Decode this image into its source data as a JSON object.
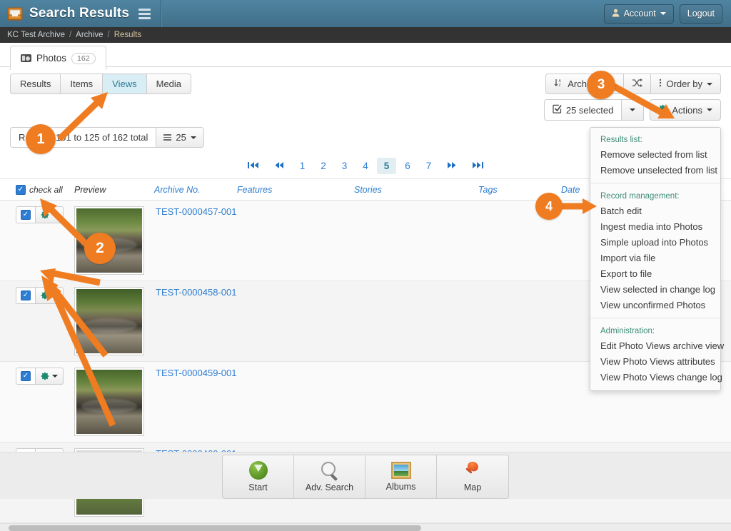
{
  "header": {
    "title": "Search Results",
    "logo_icon": "archive-box-icon",
    "menu_icon": "hamburger-icon",
    "account_label": "Account",
    "account_icon": "user-icon",
    "logout_label": "Logout"
  },
  "breadcrumb": {
    "items": [
      "KC Test Archive",
      "Archive",
      "Results"
    ],
    "separator": "/"
  },
  "tabs": {
    "photos": {
      "label": "Photos",
      "count": "162",
      "icon": "camera-icon"
    }
  },
  "subtabs": [
    {
      "label": "Results",
      "active": false
    },
    {
      "label": "Items",
      "active": false
    },
    {
      "label": "Views",
      "active": true
    },
    {
      "label": "Media",
      "active": false
    }
  ],
  "records": {
    "summary": "Records 101 to 125 of 162 total",
    "page_size": "25",
    "page_size_icon": "list-icon"
  },
  "toolbar": {
    "sort_label": "Archive No.",
    "sort_icon": "sort-alpha-icon",
    "shuffle_icon": "shuffle-icon",
    "order_by_label": "Order by",
    "order_by_icon": "dots-vertical-icon",
    "selected_label": "25 selected",
    "selected_icon": "check-square-icon",
    "actions_label": "Actions",
    "actions_icon": "gear-icon"
  },
  "pagination": {
    "first_icon": "first-page-icon",
    "prev_icon": "prev-page-icon",
    "next_icon": "next-page-icon",
    "last_icon": "last-page-icon",
    "pages": [
      "1",
      "2",
      "3",
      "4",
      "5",
      "6",
      "7"
    ],
    "current": "5"
  },
  "table": {
    "check_all_label": "check all",
    "columns": [
      "Preview",
      "Archive No.",
      "Features",
      "Stories",
      "Tags",
      "Date"
    ],
    "rows": [
      {
        "archive_no": "TEST-0000457-001",
        "checked": true,
        "thumb": "creek1",
        "gear_icon": "gear-icon"
      },
      {
        "archive_no": "TEST-0000458-001",
        "checked": true,
        "thumb": "creek2",
        "gear_icon": "gear-icon"
      },
      {
        "archive_no": "TEST-0000459-001",
        "checked": true,
        "thumb": "creek3",
        "gear_icon": "gear-icon"
      },
      {
        "archive_no": "TEST-0000460-001",
        "checked": true,
        "thumb": "creek4",
        "gear_icon": "gear-icon"
      }
    ]
  },
  "actions_menu": {
    "sections": [
      {
        "heading": "Results list:",
        "items": [
          "Remove selected from list",
          "Remove unselected from list"
        ]
      },
      {
        "heading": "Record management:",
        "items": [
          "Batch edit",
          "Ingest media into Photos",
          "Simple upload into Photos",
          "Import via file",
          "Export to file",
          "View selected in change log",
          "View unconfirmed Photos"
        ]
      },
      {
        "heading": "Administration:",
        "items": [
          "Edit Photo Views archive view",
          "View Photo Views attributes",
          "View Photo Views change log"
        ]
      }
    ]
  },
  "dock": [
    {
      "label": "Start",
      "icon": "start-icon"
    },
    {
      "label": "Adv. Search",
      "icon": "magnifier-icon"
    },
    {
      "label": "Albums",
      "icon": "picture-frame-icon"
    },
    {
      "label": "Map",
      "icon": "pushpin-icon"
    }
  ],
  "callouts": [
    {
      "number": "1"
    },
    {
      "number": "2"
    },
    {
      "number": "3"
    },
    {
      "number": "4"
    }
  ],
  "colors": {
    "accent_orange": "#f07c22",
    "link_blue": "#2d7dd2",
    "header_blue": "#46738d",
    "gear_green": "#1f8a70",
    "menu_heading": "#3f8d78"
  }
}
